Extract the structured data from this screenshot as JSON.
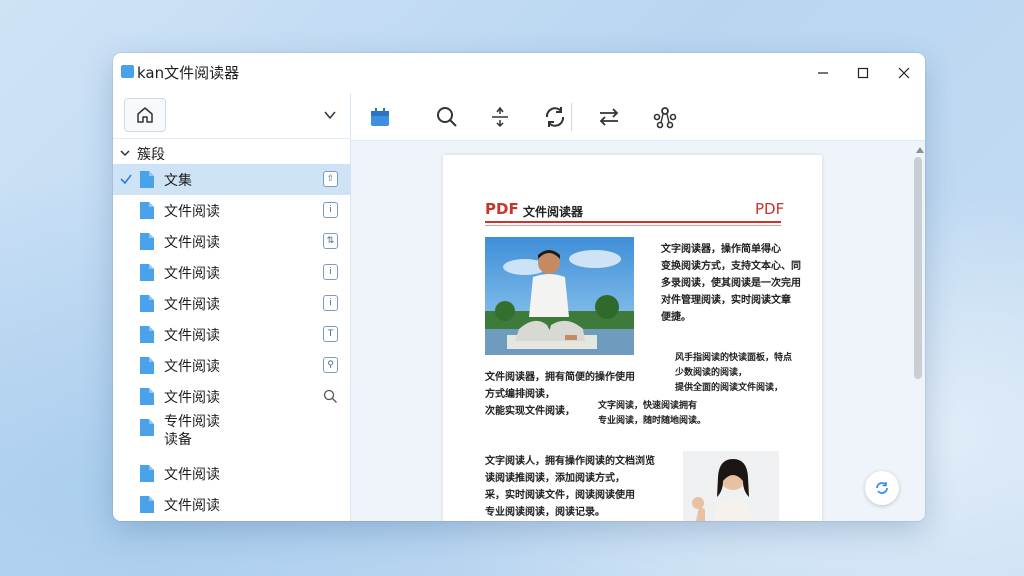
{
  "window": {
    "title": "kan文件阅读器"
  },
  "sidebar": {
    "group_label": "簇段",
    "items": [
      {
        "label": "文集",
        "selected": true
      },
      {
        "label": "文件阅读"
      },
      {
        "label": "文件阅读"
      },
      {
        "label": "文件阅读"
      },
      {
        "label": "文件阅读"
      },
      {
        "label": "文件阅读"
      },
      {
        "label": "文件阅读"
      },
      {
        "label": "文件阅读"
      },
      {
        "label": "专件阅读",
        "label2": "读备"
      },
      {
        "label": "文件阅读"
      },
      {
        "label": "文件阅读"
      }
    ]
  },
  "toolbar": {
    "icons": [
      "calendar-icon",
      "search-icon",
      "split-icon",
      "refresh-icon",
      "swap-icon",
      "share-icon"
    ]
  },
  "document": {
    "brand": "PDF",
    "title": "文件阅读器",
    "brand_right": "PDF",
    "para1": [
      "文字阅读器，操作简单得心",
      "变换阅读方式，支持文本心、同",
      "多录阅读，使其阅读是一次完用",
      "对件管理阅读，实时阅读文章",
      "便捷。"
    ],
    "para2_left": [
      "文件阅读器，拥有简便的操作使用",
      "方式编排阅读，",
      "次能实现文件阅读，"
    ],
    "para2_right": [
      "风手指阅读的快读面板，特点",
      "少数阅读的阅读，",
      "提供全面的阅读文件阅读，"
    ],
    "para3": [
      "文字阅读，快速阅读拥有",
      "专业阅读，随时随地阅读。"
    ],
    "para4": [
      "文字阅读人，拥有操作阅读的文档浏览",
      "读阅读推阅读，添加阅读方式，",
      "采，实时阅读文件，阅读阅读使用",
      "专业阅读阅读，阅读记录。"
    ]
  },
  "colors": {
    "accent": "#3d8fe0",
    "pdf_red": "#c8352e",
    "selection": "#cfe3f7"
  }
}
